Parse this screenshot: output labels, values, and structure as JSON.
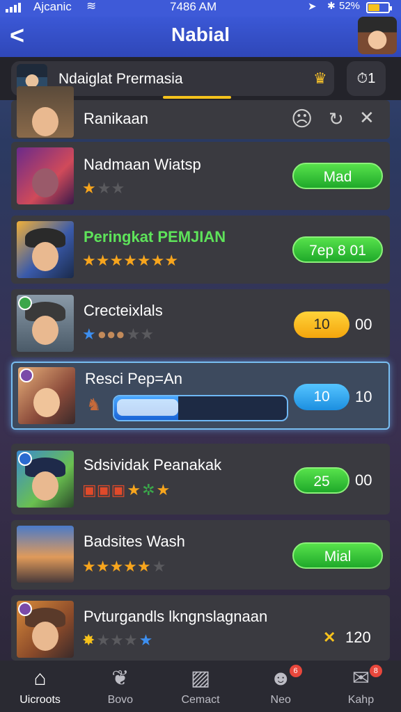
{
  "status": {
    "carrier": "Ajcanic",
    "time": "7486 AM",
    "battery": "52%"
  },
  "header": {
    "title": "Nabial"
  },
  "subbar": {
    "label": "Ndaiglat Prermasia",
    "button": "1"
  },
  "rows": [
    {
      "name": "Ranikaan"
    },
    {
      "name": "Nadmaan Wiatsp",
      "action": "Mad",
      "stars": {
        "on": 1,
        "off": 2
      }
    },
    {
      "name": "Peringkat PEMJIAN",
      "action": "7ep 8 01",
      "stars": {
        "on": 7,
        "off": 0
      }
    },
    {
      "name": "Crecteixlals",
      "pill": "10",
      "value": "00",
      "stars": {
        "on": 0,
        "off": 2
      }
    },
    {
      "name": "Resci Pep=An",
      "pill": "10",
      "value": "10",
      "progress": 0.37
    },
    {
      "name": "Sdsividak Peanakak",
      "pill": "25",
      "value": "00",
      "stars": {
        "on": 2,
        "off": 0
      }
    },
    {
      "name": "Badsites Wash",
      "action": "Mial",
      "stars": {
        "on": 5,
        "off": 1
      }
    },
    {
      "name": "Pvturgandls lkngnslagnaan",
      "value": "120",
      "stars": {
        "on": 0,
        "off": 3,
        "blue": 1
      }
    }
  ],
  "nav": [
    {
      "label": "Uicroots",
      "icon": "home-icon",
      "active": true
    },
    {
      "label": "Bovo",
      "icon": "leaf-icon"
    },
    {
      "label": "Cemact",
      "icon": "image-icon"
    },
    {
      "label": "Neo",
      "icon": "user-icon",
      "badge": "6"
    },
    {
      "label": "Kahp",
      "icon": "chat-icon",
      "badge": "8"
    }
  ],
  "colors": {
    "accent": "#3b58d6",
    "green": "#2fbf35",
    "yellow": "#f7b81c",
    "blue": "#2aa0f0"
  }
}
